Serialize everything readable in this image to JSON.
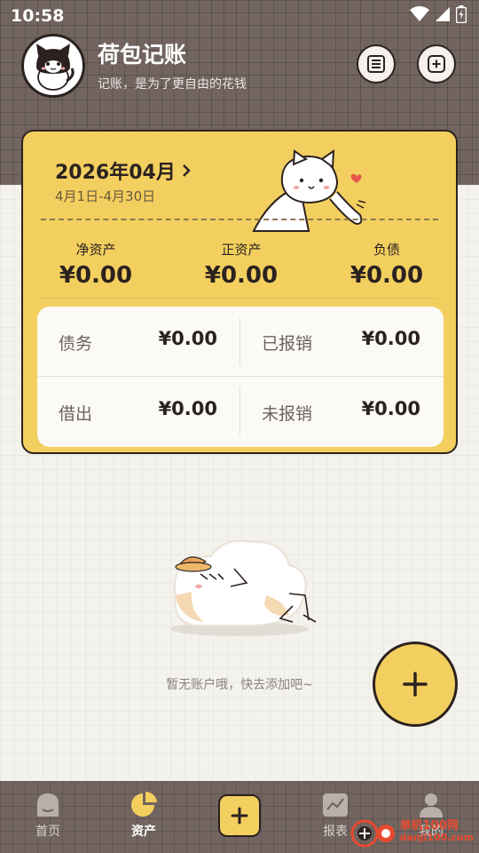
{
  "status": {
    "time": "10:58"
  },
  "header": {
    "title": "荷包记账",
    "slogan": "记账，是为了更自由的花钱",
    "icons": [
      "list-icon",
      "add-icon"
    ]
  },
  "card": {
    "month": "2026年04月",
    "range": "4月1日-4月30日",
    "stats": [
      {
        "label": "净资产",
        "value": "¥0.00"
      },
      {
        "label": "正资产",
        "value": "¥0.00"
      },
      {
        "label": "负债",
        "value": "¥0.00"
      }
    ],
    "details": [
      {
        "label": "债务",
        "value": "¥0.00"
      },
      {
        "label": "已报销",
        "value": "¥0.00"
      },
      {
        "label": "借出",
        "value": "¥0.00"
      },
      {
        "label": "未报销",
        "value": "¥0.00"
      }
    ]
  },
  "empty": {
    "text": "暂无账户哦，快去添加吧~"
  },
  "tabbar": {
    "tabs": [
      {
        "label": "首页",
        "icon": "home-icon"
      },
      {
        "label": "资产",
        "icon": "pie-chart-icon"
      },
      {
        "label": "报表",
        "icon": "report-icon"
      },
      {
        "label": "我的",
        "icon": "profile-icon"
      }
    ]
  },
  "watermark": {
    "line1": "单机100网",
    "line2": "danji100.com"
  },
  "colors": {
    "accent": "#f3cf5f",
    "header": "#726560",
    "ink": "#2b2220"
  }
}
